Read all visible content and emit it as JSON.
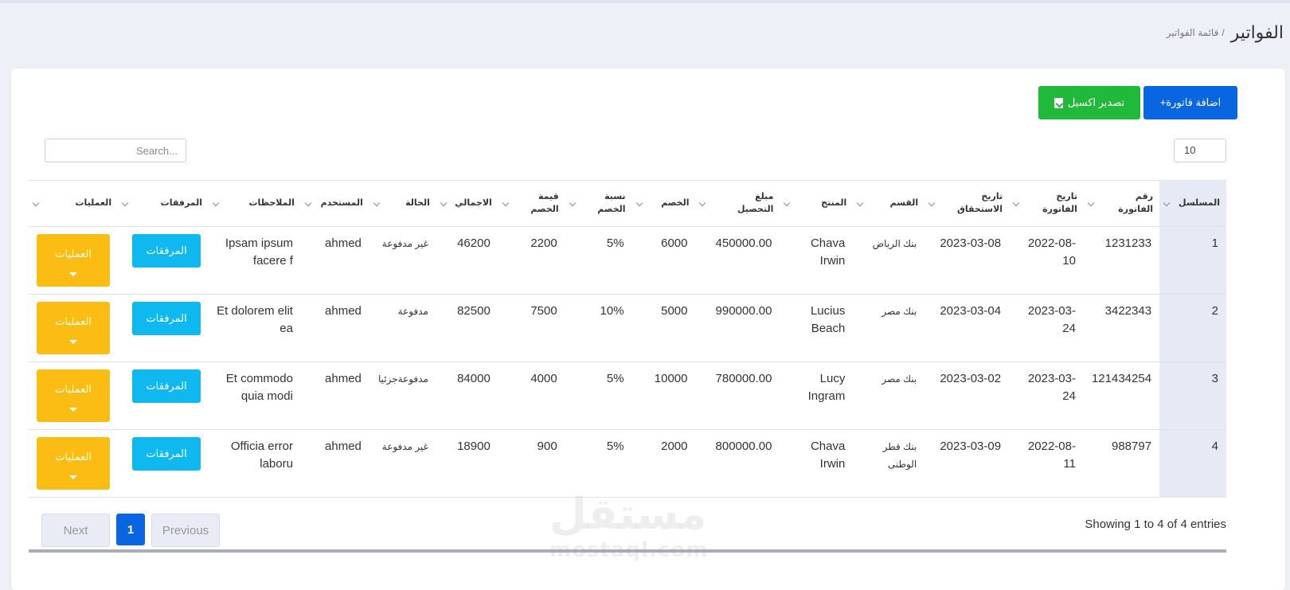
{
  "header": {
    "title": "الفواتير",
    "breadcrumb_sep": "/",
    "breadcrumb_current": "قائمة الفواتير"
  },
  "toolbar": {
    "add_label": "+اضافة فاتورة",
    "export_label": "تصدير اكسيل",
    "page_length": "10",
    "search_placeholder": "Search..."
  },
  "colors": {
    "primary": "#0a66e0",
    "success": "#21b93a",
    "info": "#0fb9ef",
    "warning": "#fbbd14"
  },
  "table": {
    "columns": [
      "المسلسل",
      "رقم الفاتورة",
      "تاريخ الفاتورة",
      "تاريخ الاستحقاق",
      "القسم",
      "المنتج",
      "مبلغ التحصيل",
      "الخصم",
      "نسبة الخصم",
      "قيمة الخصم",
      "الاجمالي",
      "الحالة",
      "المستخدم",
      "الملاحظات",
      "المرفقات",
      "العمليات"
    ],
    "rows": [
      {
        "serial": "1",
        "invoice_no": "1231233",
        "invoice_date": "2022-08-10",
        "due_date": "2023-03-08",
        "section": "بنك الرياض",
        "product": "Chava Irwin",
        "amount": "450000.00",
        "discount": "6000",
        "rate": "5%",
        "discount_value": "2200",
        "total": "46200",
        "status": "غير مدفوعة",
        "user": "ahmed",
        "notes": "Ipsam ipsum facere f",
        "attach_label": "المرفقات",
        "ops_label": "العمليات"
      },
      {
        "serial": "2",
        "invoice_no": "3422343",
        "invoice_date": "2023-03-24",
        "due_date": "2023-03-04",
        "section": "بنك مصر",
        "product": "Lucius Beach",
        "amount": "990000.00",
        "discount": "5000",
        "rate": "10%",
        "discount_value": "7500",
        "total": "82500",
        "status": "مدفوعة",
        "user": "ahmed",
        "notes": "Et dolorem elit ea",
        "attach_label": "المرفقات",
        "ops_label": "العمليات"
      },
      {
        "serial": "3",
        "invoice_no": "121434254",
        "invoice_date": "2023-03-24",
        "due_date": "2023-03-02",
        "section": "بنك مصر",
        "product": "Lucy Ingram",
        "amount": "780000.00",
        "discount": "10000",
        "rate": "5%",
        "discount_value": "4000",
        "total": "84000",
        "status": "مدفوعةجزئيا",
        "user": "ahmed",
        "notes": "Et commodo quia modi",
        "attach_label": "المرفقات",
        "ops_label": "العمليات"
      },
      {
        "serial": "4",
        "invoice_no": "988797",
        "invoice_date": "2022-08-11",
        "due_date": "2023-03-09",
        "section": "بنك قطر الوطنى",
        "product": "Chava Irwin",
        "amount": "800000.00",
        "discount": "2000",
        "rate": "5%",
        "discount_value": "900",
        "total": "18900",
        "status": "غير مدفوعة",
        "user": "ahmed",
        "notes": "Officia error laboru",
        "attach_label": "المرفقات",
        "ops_label": "العمليات"
      }
    ]
  },
  "footer": {
    "info": "Showing 1 to 4 of 4 entries",
    "next": "Next",
    "current_page": "1",
    "previous": "Previous"
  },
  "watermark": {
    "line1": "مستقل",
    "line2": "mostaql.com"
  }
}
